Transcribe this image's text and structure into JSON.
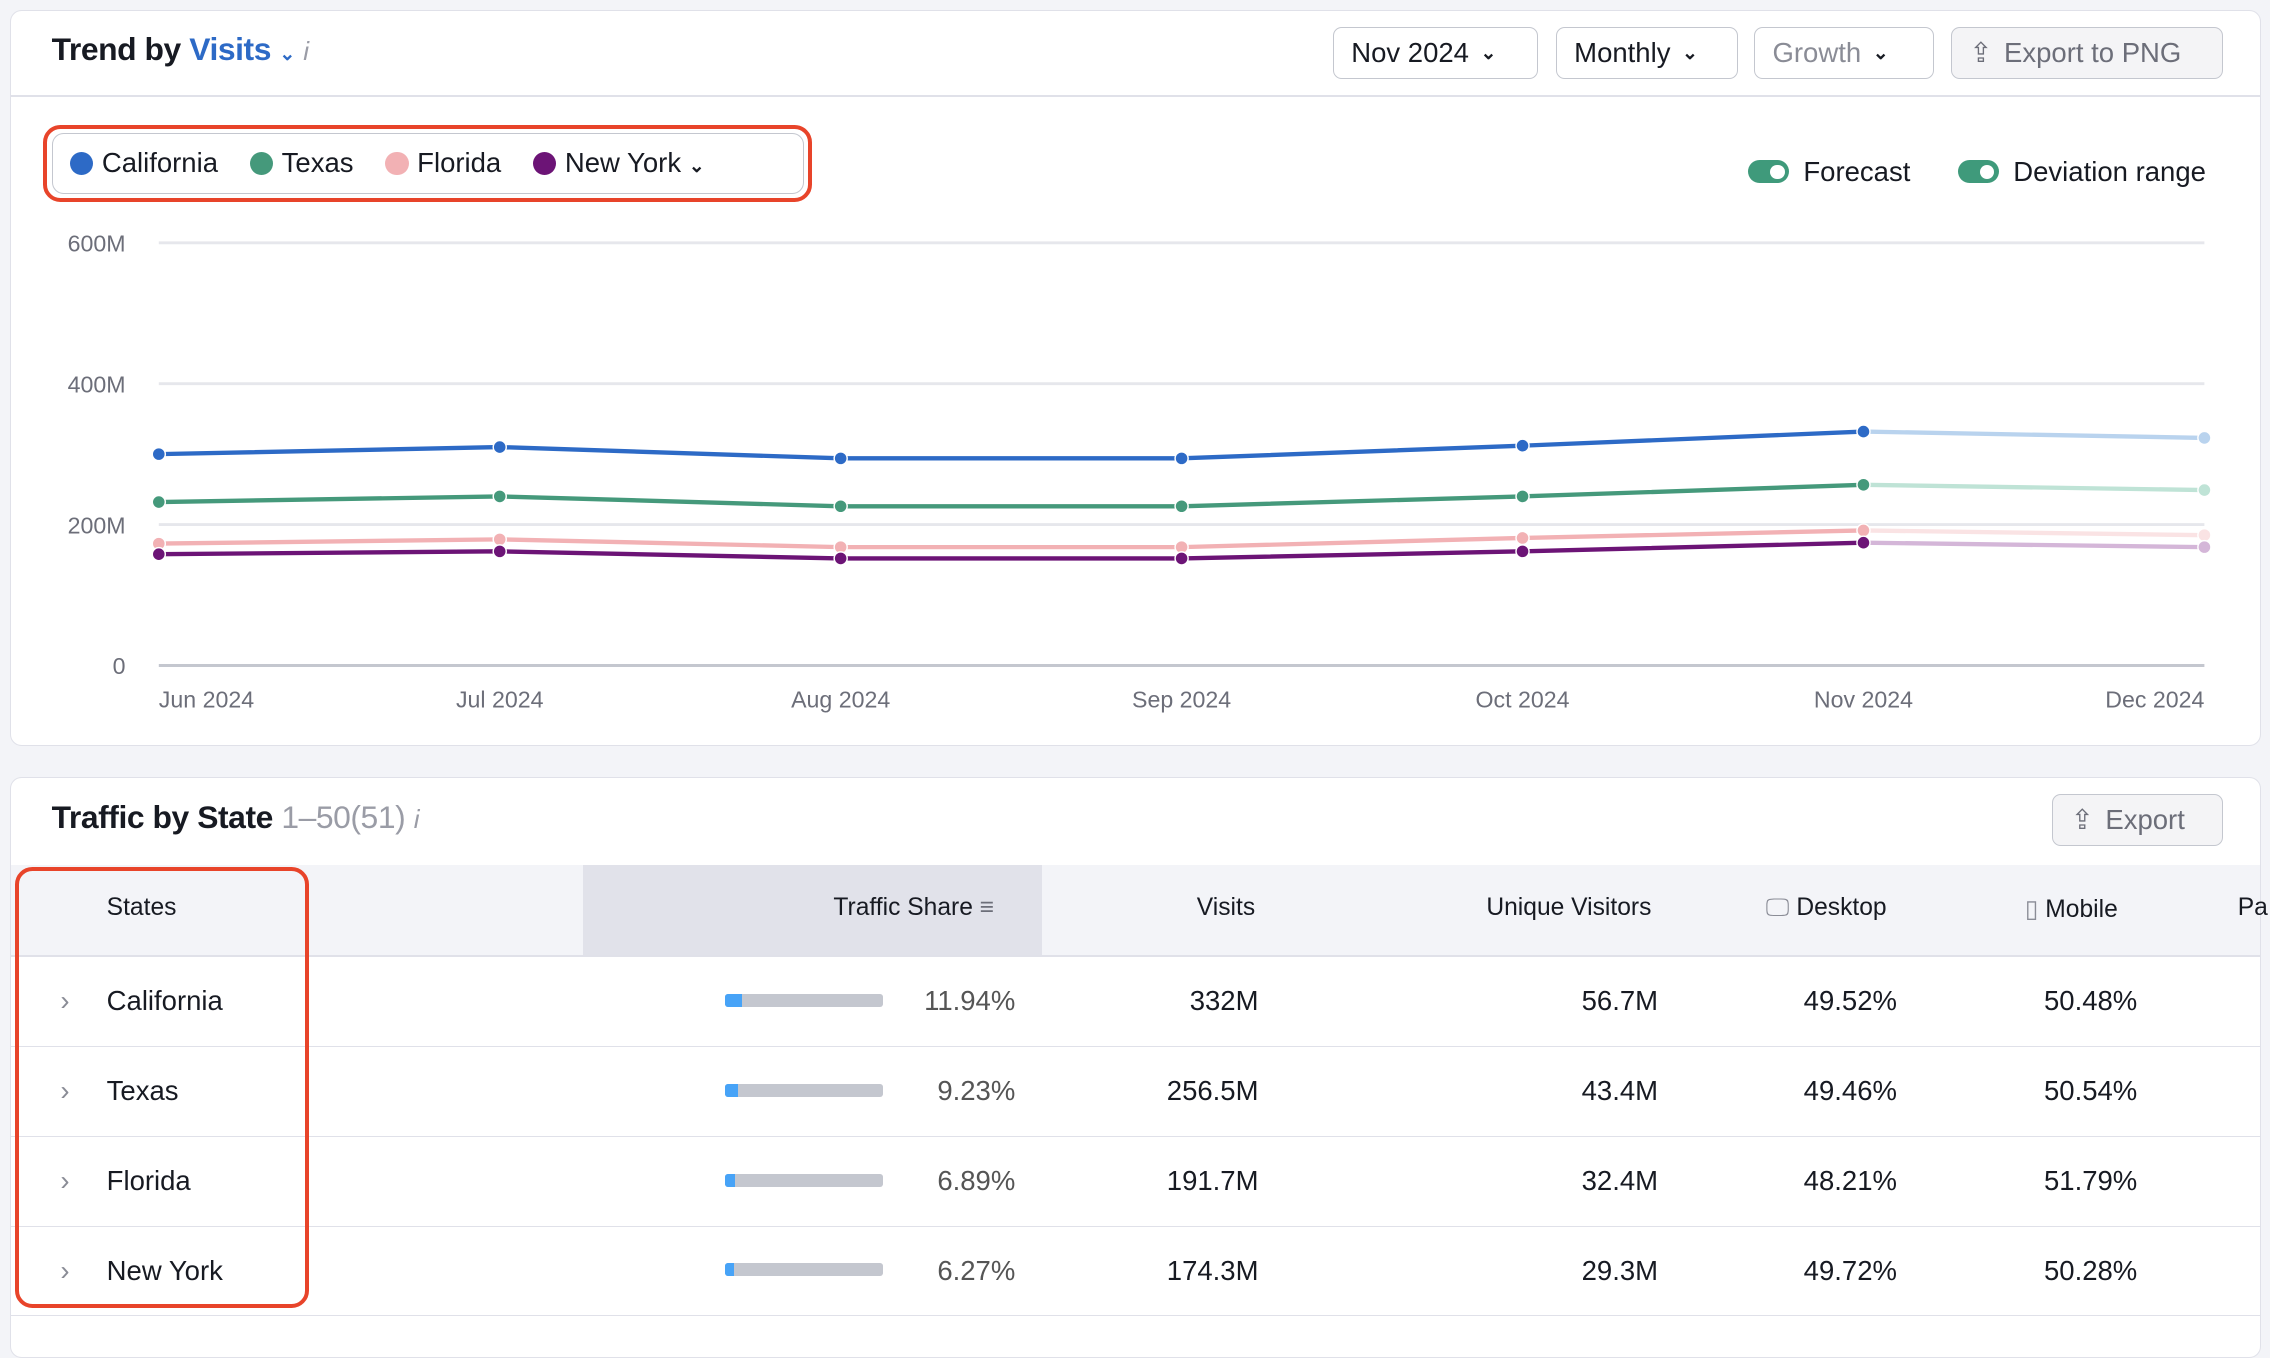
{
  "trend": {
    "title_prefix": "Trend by",
    "metric": "Visits",
    "info": "i",
    "controls": {
      "date": "Nov 2024",
      "period": "Monthly",
      "mode": "Growth",
      "export": "Export to PNG"
    },
    "toggles": [
      {
        "label": "Forecast",
        "on": true
      },
      {
        "label": "Deviation range",
        "on": true
      }
    ]
  },
  "chart_data": {
    "type": "line",
    "x": [
      "Jun 2024",
      "Jul 2024",
      "Aug 2024",
      "Sep 2024",
      "Oct 2024",
      "Nov 2024",
      "Dec 2024"
    ],
    "ylim": [
      0,
      600
    ],
    "yticks": [
      "0",
      "200M",
      "400M",
      "600M"
    ],
    "ytick_values": [
      0,
      200,
      400,
      600
    ],
    "grid": true,
    "legend": "top-left",
    "forecast_from": "Nov 2024",
    "series": [
      {
        "name": "California",
        "color": "#2d6ac6",
        "forecast_color": "#b9d3ee",
        "values": [
          300,
          310,
          294,
          294,
          312,
          332,
          323
        ]
      },
      {
        "name": "Texas",
        "color": "#45997b",
        "forecast_color": "#bfe3d6",
        "values": [
          232,
          240,
          226,
          226,
          240,
          256.5,
          249
        ]
      },
      {
        "name": "Florida",
        "color": "#f2b1b4",
        "forecast_color": "#fae3e4",
        "values": [
          173,
          179,
          168,
          168,
          181,
          191.7,
          185
        ]
      },
      {
        "name": "New York",
        "color": "#6c1476",
        "forecast_color": "#d4b6d8",
        "values": [
          158,
          162,
          152,
          152,
          162,
          174.3,
          168
        ]
      }
    ]
  },
  "table": {
    "title": "Traffic by State",
    "range": "1–50",
    "total": "(51)",
    "info": "i",
    "export": "Export",
    "columns": [
      "States",
      "Traffic Share",
      "Visits",
      "Unique Visitors",
      "Desktop",
      "Mobile",
      "Pa"
    ],
    "rows": [
      {
        "state": "California",
        "share": "11.94%",
        "share_pct": 11.94,
        "visits": "332M",
        "unique": "56.7M",
        "desktop": "49.52%",
        "mobile": "50.48%"
      },
      {
        "state": "Texas",
        "share": "9.23%",
        "share_pct": 9.23,
        "visits": "256.5M",
        "unique": "43.4M",
        "desktop": "49.46%",
        "mobile": "50.54%"
      },
      {
        "state": "Florida",
        "share": "6.89%",
        "share_pct": 6.89,
        "visits": "191.7M",
        "unique": "32.4M",
        "desktop": "48.21%",
        "mobile": "51.79%"
      },
      {
        "state": "New York",
        "share": "6.27%",
        "share_pct": 6.27,
        "visits": "174.3M",
        "unique": "29.3M",
        "desktop": "49.72%",
        "mobile": "50.28%"
      }
    ]
  }
}
